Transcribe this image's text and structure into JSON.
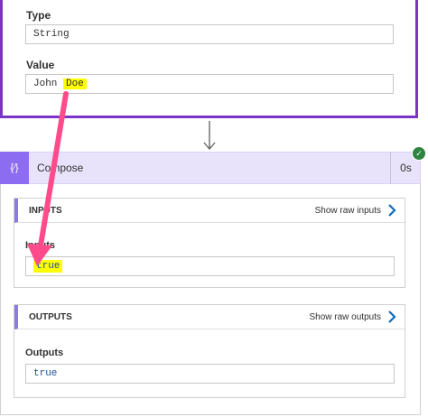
{
  "previous_action": {
    "type_label": "Type",
    "type_value": "String",
    "value_label": "Value",
    "value_value_plain": "John ",
    "value_value_highlight": "Doe"
  },
  "compose": {
    "icon_glyph": "{∕}",
    "title": "Compose",
    "duration": "0s",
    "status": "succeeded"
  },
  "inputs_section": {
    "title": "INPUTS",
    "show_raw_label": "Show raw inputs",
    "field_label": "Inputs",
    "field_value": "true"
  },
  "outputs_section": {
    "title": "OUTPUTS",
    "show_raw_label": "Show raw outputs",
    "field_label": "Outputs",
    "field_value": "true"
  },
  "colors": {
    "accent_purple": "#7a35c6",
    "compose_icon_bg": "#8c6cf0",
    "compose_header_bg": "#e8e3fb",
    "highlight": "#ffff00",
    "annotation_arrow": "#ff4b8b",
    "success_green": "#2e8540",
    "link_blue": "#0f6cbd"
  }
}
